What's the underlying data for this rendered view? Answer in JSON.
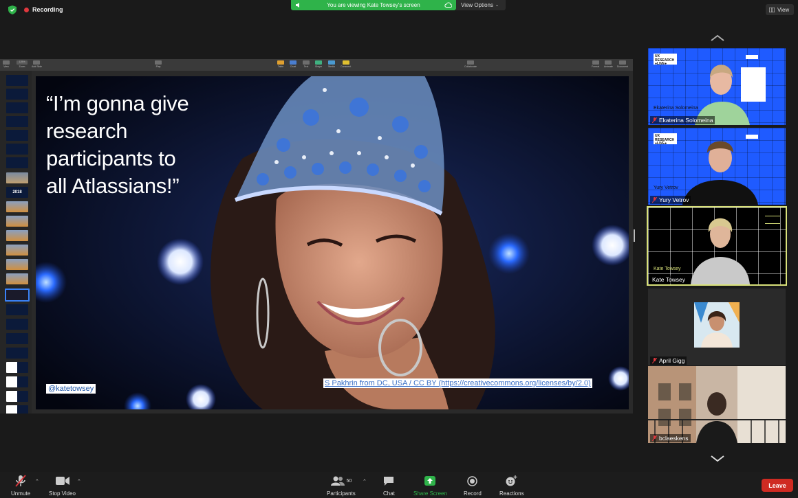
{
  "top": {
    "recording_label": "Recording",
    "viewing_label": "You are viewing Kate Towsey's screen",
    "view_options_label": "View Options",
    "view_label": "View"
  },
  "slide": {
    "quote_lines": [
      "“I’m gonna give",
      "research",
      "participants to",
      "all Atlassians!”"
    ],
    "handle": "@katetowsey",
    "credit": "S Pakhrin from DC, USA / CC BY (https://creativecommons.org/licenses/by/2.0)",
    "thumb_year": "2018"
  },
  "keynote_toolbar": {
    "view": "View",
    "zoom": "Zoom",
    "add_slide": "Add Slide",
    "zoom_value": "125%",
    "play": "Play",
    "table": "Table",
    "chart": "Chart",
    "text": "Text",
    "shape": "Shape",
    "media": "Media",
    "comment": "Comment",
    "collaborate": "Collaborate",
    "format": "Format",
    "animate": "Animate",
    "document": "Document"
  },
  "participants": [
    {
      "name": "Ekaterina Solomeina",
      "bg_name": "Ekaterina Solomeina",
      "tag": "UX RESEARCH ●LIVE●"
    },
    {
      "name": "Yury Vetrov",
      "bg_name": "Yury Vetrov",
      "tag": "UX RESEARCH ●LIVE●"
    },
    {
      "name": "Kate Towsey",
      "bg_name": "Kate Towsey"
    },
    {
      "name": "April Gigg"
    },
    {
      "name": "bclaeskens"
    }
  ],
  "bottom": {
    "unmute": "Unmute",
    "stop_video": "Stop Video",
    "participants": "Participants",
    "participants_count": "50",
    "chat": "Chat",
    "share_screen": "Share Screen",
    "record": "Record",
    "reactions": "Reactions",
    "leave": "Leave"
  },
  "colors": {
    "share_green": "#2fb34a",
    "leave_red": "#cf2b22",
    "active_speaker_border": "#d9e27a",
    "background_blue": "#1f5bff"
  }
}
